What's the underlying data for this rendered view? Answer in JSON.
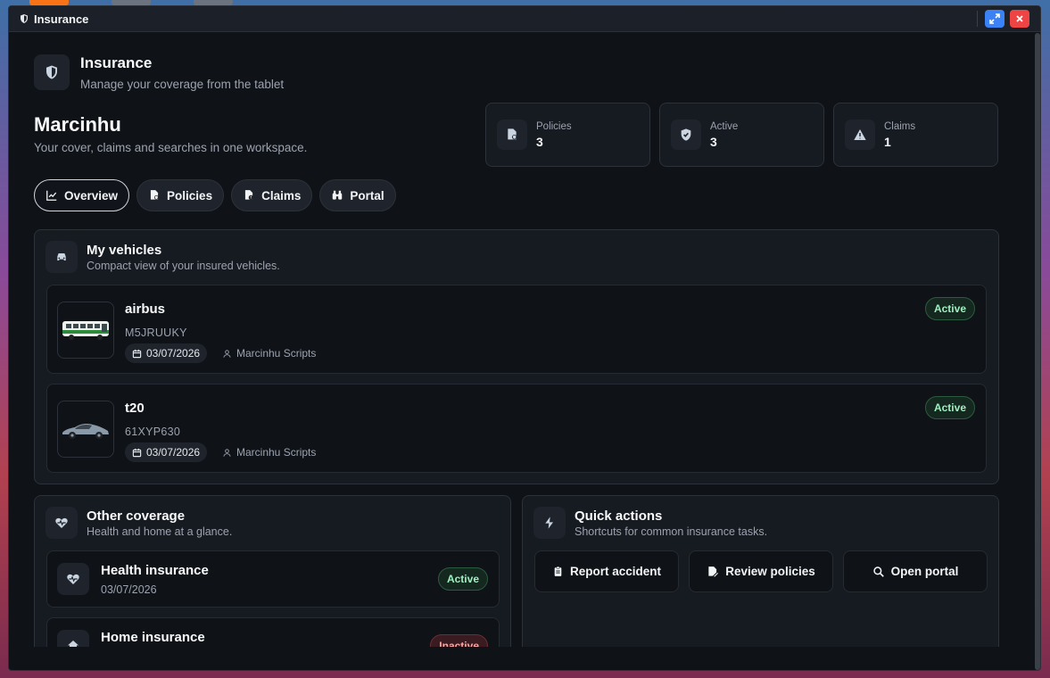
{
  "window": {
    "title": "Insurance"
  },
  "app": {
    "title": "Insurance",
    "subtitle": "Manage your coverage from the tablet"
  },
  "user": {
    "name": "Marcinhu",
    "subtitle": "Your cover, claims and searches in one workspace."
  },
  "stats": [
    {
      "label": "Policies",
      "value": "3",
      "icon": "policy-icon"
    },
    {
      "label": "Active",
      "value": "3",
      "icon": "shield-check-icon"
    },
    {
      "label": "Claims",
      "value": "1",
      "icon": "warning-icon"
    }
  ],
  "tabs": [
    {
      "label": "Overview",
      "icon": "chart-line-icon",
      "active": true
    },
    {
      "label": "Policies",
      "icon": "policy-icon",
      "active": false
    },
    {
      "label": "Claims",
      "icon": "claims-icon",
      "active": false
    },
    {
      "label": "Portal",
      "icon": "binoculars-icon",
      "active": false
    }
  ],
  "vehicles": {
    "title": "My vehicles",
    "subtitle": "Compact view of your insured vehicles.",
    "items": [
      {
        "name": "airbus",
        "plate": "M5JRUUKY",
        "date": "03/07/2026",
        "owner": "Marcinhu Scripts",
        "status": "Active"
      },
      {
        "name": "t20",
        "plate": "61XYP630",
        "date": "03/07/2026",
        "owner": "Marcinhu Scripts",
        "status": "Active"
      }
    ]
  },
  "coverage": {
    "title": "Other coverage",
    "subtitle": "Health and home at a glance.",
    "items": [
      {
        "title": "Health insurance",
        "date": "03/07/2026",
        "status": "Active"
      },
      {
        "title": "Home insurance",
        "date": "",
        "status": "Inactive"
      }
    ]
  },
  "quick_actions": {
    "title": "Quick actions",
    "subtitle": "Shortcuts for common insurance tasks.",
    "buttons": [
      {
        "label": "Report accident"
      },
      {
        "label": "Review policies"
      },
      {
        "label": "Open portal"
      }
    ]
  },
  "colors": {
    "accent_active": "#9ff0c0",
    "accent_inactive": "#fca5a5",
    "window_bg": "#0f1217",
    "close": "#ef4444",
    "maximize": "#3b82f6"
  }
}
